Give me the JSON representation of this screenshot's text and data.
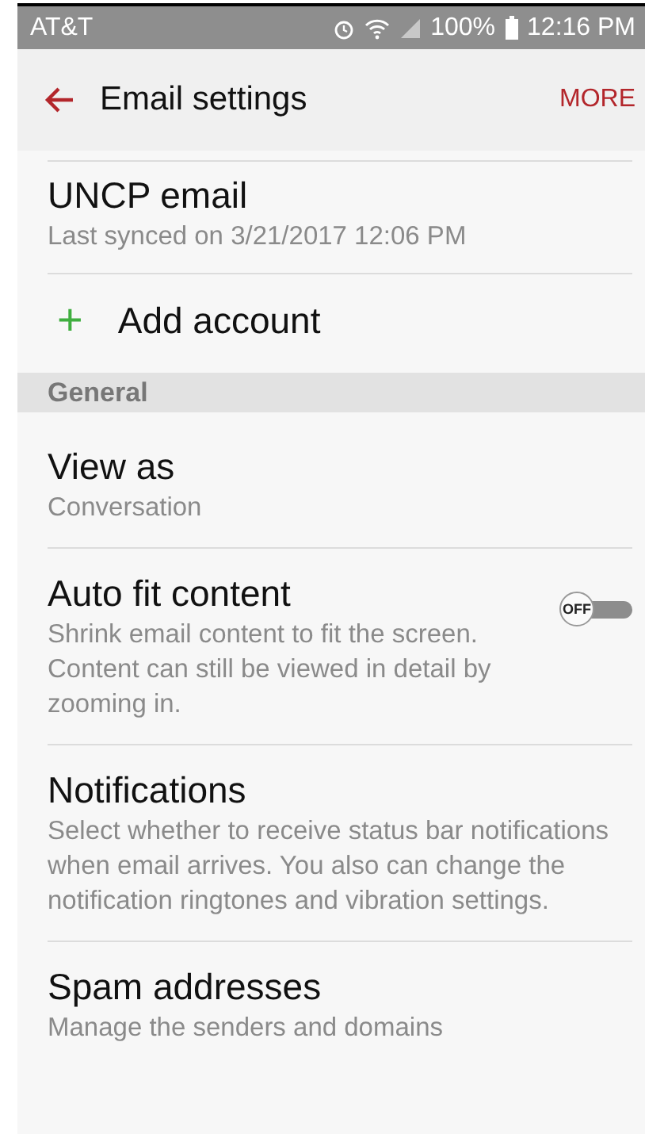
{
  "status_bar": {
    "carrier": "AT&T",
    "battery": "100%",
    "time": "12:16 PM"
  },
  "app_bar": {
    "title": "Email settings",
    "action": "MORE"
  },
  "items": [
    {
      "kind": "account",
      "title": "UNCP email",
      "subtitle": "Last synced on 3/21/2017 12:06 PM"
    },
    {
      "kind": "add",
      "icon": "+",
      "title": "Add account"
    },
    {
      "kind": "header",
      "title": "General"
    },
    {
      "kind": "setting",
      "title": "View as",
      "subtitle": "Conversation"
    },
    {
      "kind": "toggle",
      "title": "Auto fit content",
      "subtitle": "Shrink email content to fit the screen. Content can still be viewed in detail by zooming in.",
      "on": false,
      "switch_label": "OFF"
    },
    {
      "kind": "setting",
      "title": "Notifications",
      "subtitle": "Select whether to receive status bar notifications when email arrives. You also can change the notification ringtones and vibration settings."
    },
    {
      "kind": "setting",
      "title": "Spam addresses",
      "subtitle": "Manage the senders and domains"
    }
  ]
}
